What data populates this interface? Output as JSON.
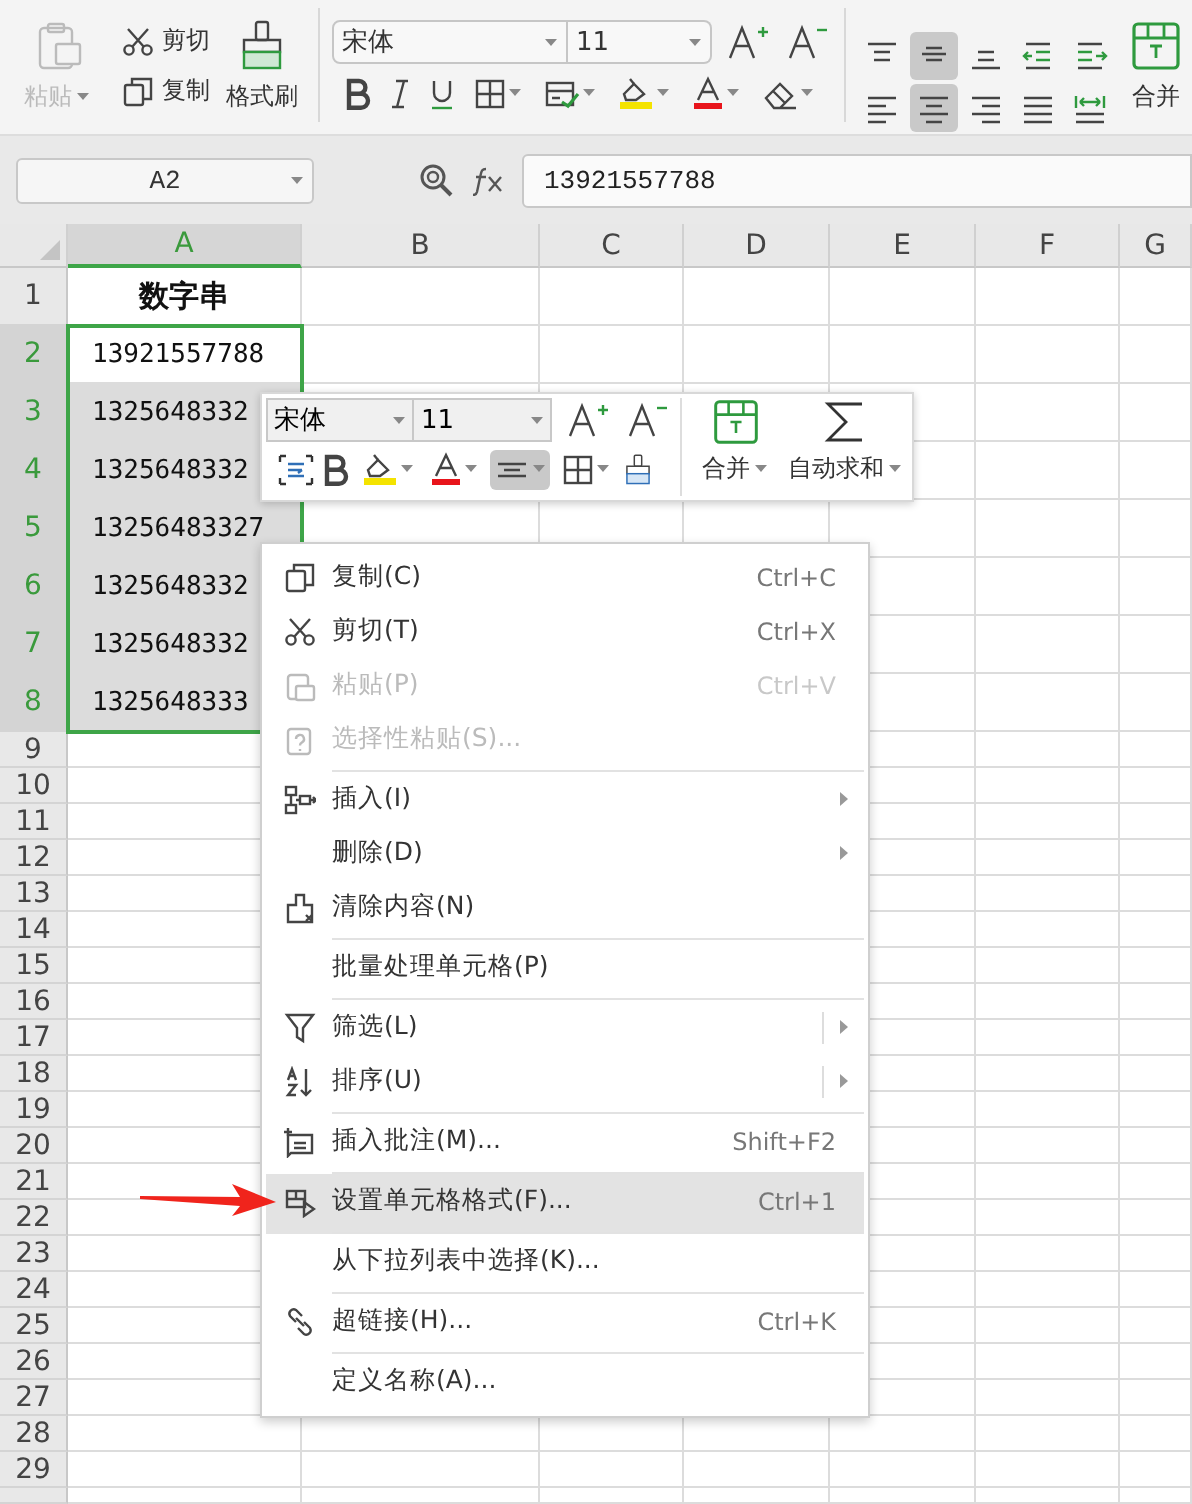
{
  "ribbon": {
    "paste": {
      "label": "粘贴",
      "disabled": true
    },
    "cut": "剪切",
    "copy": "复制",
    "format_painter": "格式刷",
    "font_name": "宋体",
    "font_size": "11",
    "align_buttons": [
      {
        "selected": false
      },
      {
        "selected": true
      },
      {
        "selected": false
      },
      {
        "selected": false
      },
      {
        "selected": false
      },
      {
        "selected": false
      },
      {
        "selected": true
      },
      {
        "selected": false
      },
      {
        "selected": false
      },
      {
        "selected": false
      }
    ],
    "merge": "合并"
  },
  "formula_bar": {
    "name_box": "A2",
    "value": "13921557788"
  },
  "sheet": {
    "columns": [
      {
        "label": "A",
        "selected": true
      },
      {
        "label": "B",
        "selected": false
      },
      {
        "label": "C",
        "selected": false
      },
      {
        "label": "D",
        "selected": false
      },
      {
        "label": "E",
        "selected": false
      },
      {
        "label": "F",
        "selected": false
      },
      {
        "label": "G",
        "selected": false
      }
    ],
    "rows": [
      {
        "label": "1",
        "selected": false,
        "cells": [
          {
            "text": "数字串",
            "selected": false,
            "bold": true
          }
        ]
      },
      {
        "label": "2",
        "selected": true,
        "cells": [
          {
            "text": "13921557788",
            "selected": false,
            "bold": false
          }
        ]
      },
      {
        "label": "3",
        "selected": true,
        "cells": [
          {
            "text": "1325648332",
            "selected": true,
            "bold": false
          }
        ]
      },
      {
        "label": "4",
        "selected": true,
        "cells": [
          {
            "text": "1325648332",
            "selected": true,
            "bold": false
          }
        ]
      },
      {
        "label": "5",
        "selected": true,
        "cells": [
          {
            "text": "13256483327",
            "selected": true,
            "bold": false
          }
        ]
      },
      {
        "label": "6",
        "selected": true,
        "cells": [
          {
            "text": "1325648332",
            "selected": true,
            "bold": false
          }
        ]
      },
      {
        "label": "7",
        "selected": true,
        "cells": [
          {
            "text": "1325648332",
            "selected": true,
            "bold": false
          }
        ]
      },
      {
        "label": "8",
        "selected": true,
        "cells": [
          {
            "text": "1325648333",
            "selected": true,
            "bold": false
          }
        ]
      },
      {
        "label": "9",
        "selected": false
      },
      {
        "label": "10",
        "selected": false
      },
      {
        "label": "11",
        "selected": false
      },
      {
        "label": "12",
        "selected": false
      },
      {
        "label": "13",
        "selected": false
      },
      {
        "label": "14",
        "selected": false
      },
      {
        "label": "15",
        "selected": false
      },
      {
        "label": "16",
        "selected": false
      },
      {
        "label": "17",
        "selected": false
      },
      {
        "label": "18",
        "selected": false
      },
      {
        "label": "19",
        "selected": false
      },
      {
        "label": "20",
        "selected": false
      },
      {
        "label": "21",
        "selected": false
      },
      {
        "label": "22",
        "selected": false
      },
      {
        "label": "23",
        "selected": false
      },
      {
        "label": "24",
        "selected": false
      },
      {
        "label": "25",
        "selected": false
      },
      {
        "label": "26",
        "selected": false
      },
      {
        "label": "27",
        "selected": false
      },
      {
        "label": "28",
        "selected": false
      },
      {
        "label": "29",
        "selected": false
      }
    ]
  },
  "mini_toolbar": {
    "font_name": "宋体",
    "font_size": "11",
    "center_align": {
      "selected": true
    },
    "merge": "合并",
    "autosum": "自动求和"
  },
  "context_menu": [
    {
      "kind": "plain",
      "label": "复制(C)",
      "shortcut": "Ctrl+C",
      "disabled": false,
      "selected": false,
      "separator_after": false
    },
    {
      "kind": "plain",
      "label": "剪切(T)",
      "shortcut": "Ctrl+X",
      "disabled": false,
      "selected": false,
      "separator_after": false
    },
    {
      "kind": "plain",
      "label": "粘贴(P)",
      "shortcut": "Ctrl+V",
      "disabled": true,
      "selected": false,
      "separator_after": false
    },
    {
      "kind": "plain",
      "label": "选择性粘贴(S)...",
      "disabled": true,
      "selected": false,
      "separator_after": true
    },
    {
      "kind": "submenu",
      "label": "插入(I)",
      "disabled": false,
      "selected": false,
      "separator_after": false
    },
    {
      "kind": "submenu",
      "label": "删除(D)",
      "disabled": false,
      "selected": false,
      "separator_after": false
    },
    {
      "kind": "plain",
      "label": "清除内容(N)",
      "disabled": false,
      "selected": false,
      "separator_after": true
    },
    {
      "kind": "plain",
      "label": "批量处理单元格(P)",
      "disabled": false,
      "selected": false,
      "separator_after": true
    },
    {
      "kind": "split_submenu",
      "label": "筛选(L)",
      "disabled": false,
      "selected": false,
      "separator_after": false
    },
    {
      "kind": "split_submenu",
      "label": "排序(U)",
      "disabled": false,
      "selected": false,
      "separator_after": true
    },
    {
      "kind": "plain",
      "label": "插入批注(M)...",
      "shortcut": "Shift+F2",
      "disabled": false,
      "selected": false,
      "separator_after": true
    },
    {
      "kind": "plain",
      "label": "设置单元格格式(F)...",
      "shortcut": "Ctrl+1",
      "disabled": false,
      "selected": true,
      "separator_after": true
    },
    {
      "kind": "plain",
      "label": "从下拉列表中选择(K)...",
      "disabled": false,
      "selected": false,
      "separator_after": true
    },
    {
      "kind": "plain",
      "label": "超链接(H)...",
      "shortcut": "Ctrl+K",
      "disabled": false,
      "selected": false,
      "separator_after": true
    },
    {
      "kind": "plain",
      "label": "定义名称(A)...",
      "disabled": false,
      "selected": false,
      "separator_after": false
    }
  ]
}
